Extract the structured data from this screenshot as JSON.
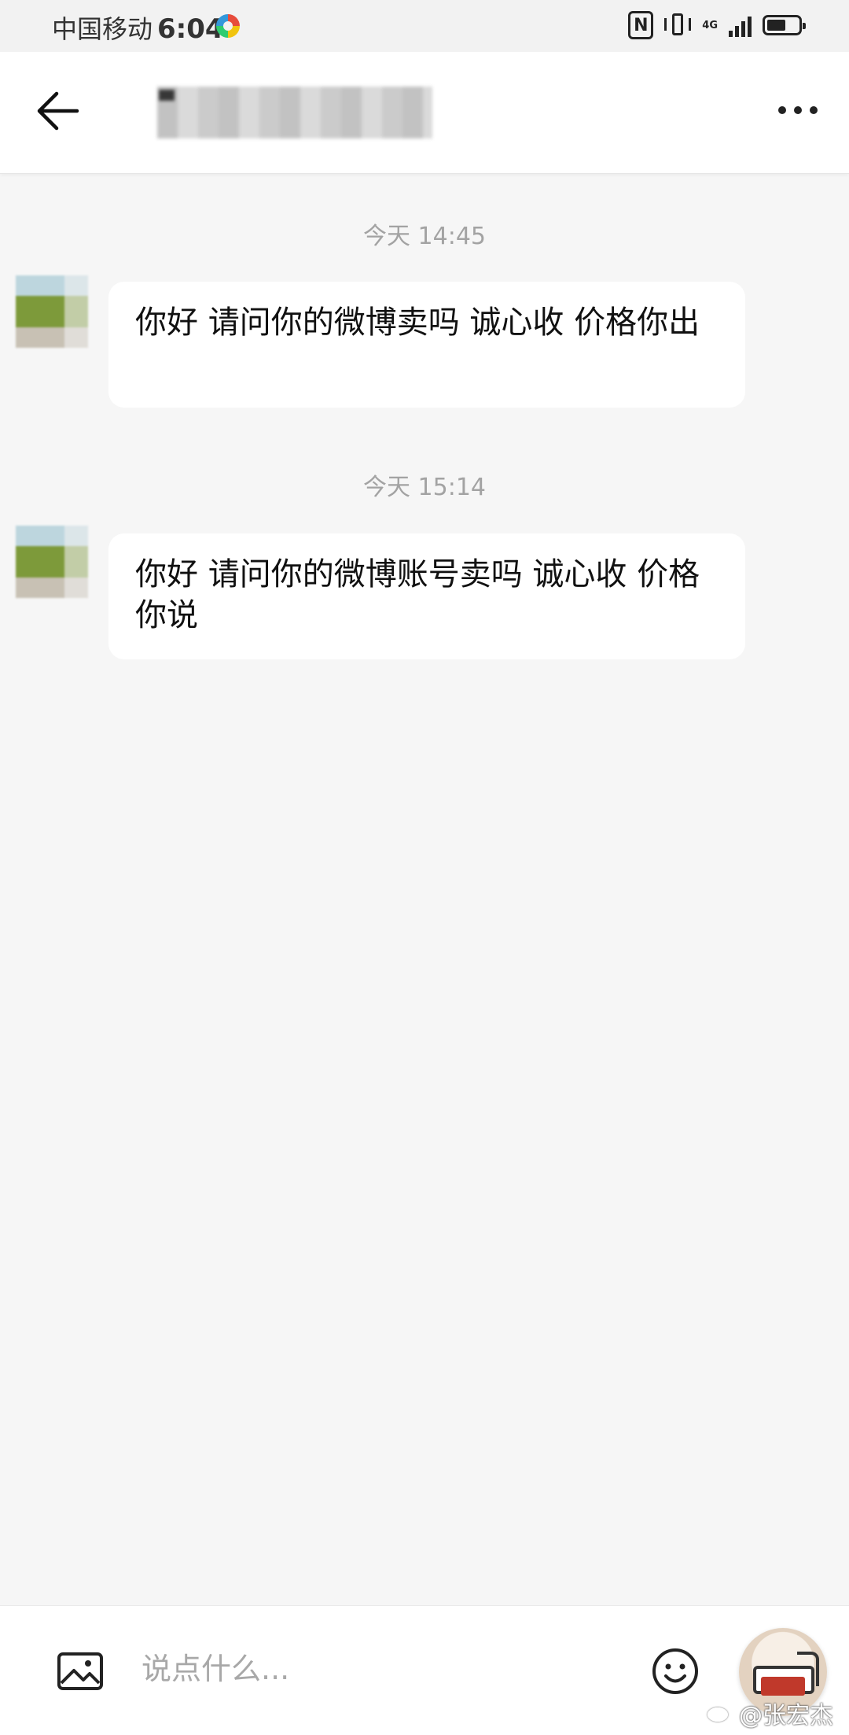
{
  "status_bar": {
    "carrier": "中国移动",
    "time": "6:04",
    "nfc": "N",
    "network": "4G",
    "battery_level": 0.6
  },
  "header": {
    "back_icon": "arrow-left-icon",
    "more_icon": "more-horizontal-icon"
  },
  "messages": [
    {
      "timestamp": "今天 14:45",
      "text": "你好 请问你的微博卖吗 诚心收 价格你出"
    },
    {
      "timestamp": "今天 15:14",
      "text": "你好 请问你的微博账号卖吗 诚心收 价格你说"
    }
  ],
  "composer": {
    "image_icon": "image-icon",
    "placeholder": "说点什么...",
    "emoji_icon": "emoji-icon",
    "action_icon": "floating-avatar-icon"
  },
  "watermark": {
    "icon": "weibo-icon",
    "text": "@张宏杰"
  },
  "colors": {
    "background": "#f6f6f6",
    "bubble": "#ffffff",
    "timestamp": "#a3a3a3"
  }
}
